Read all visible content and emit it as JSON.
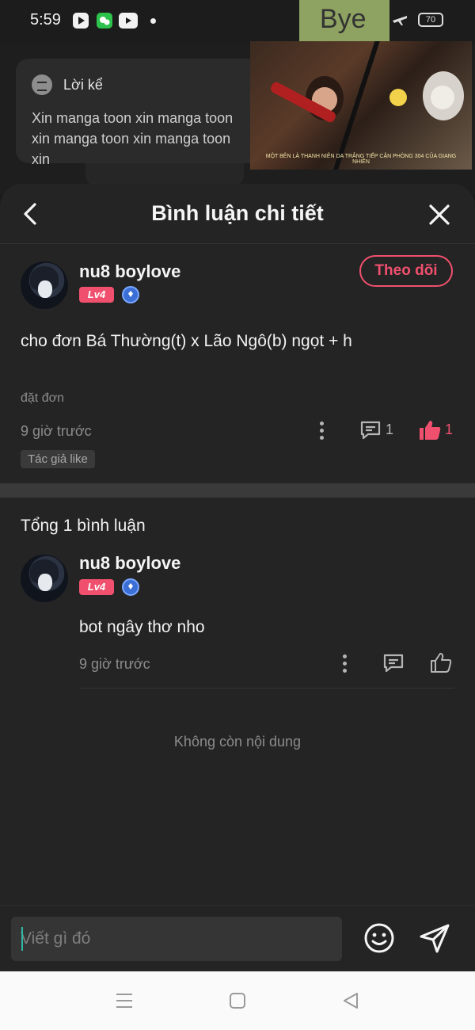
{
  "status_bar": {
    "time": "5:59",
    "battery": "70",
    "icons": [
      "play-store-icon",
      "wechat-icon",
      "youtube-icon",
      "alarm-icon",
      "wifi-icon",
      "airplane-icon",
      "battery-icon"
    ]
  },
  "background_story": {
    "tag_label": "Lời kể",
    "text": "Xin manga toon xin manga toon xin manga toon xin manga toon xin"
  },
  "video_overlay": {
    "bye_label": "Bye",
    "caption": "MỘT BÊN LÀ THANH NIÊN DA TRẮNG TIẾP CẬN PHÒNG 304 CỦA GIANG NHIÊN"
  },
  "sheet": {
    "title": "Bình luận chi tiết"
  },
  "main_comment": {
    "username": "nu8 boylove",
    "level": "Lv4",
    "follow_label": "Theo dõi",
    "text": "cho đơn Bá Thường(t) x Lão Ngô(b) ngọt + h",
    "sub_label": "đặt đơn",
    "time": "9 giờ trước",
    "reply_count": "1",
    "like_count": "1",
    "author_like_badge": "Tác giả like"
  },
  "replies": {
    "total_label": "Tổng 1 bình luận",
    "items": [
      {
        "username": "nu8 boylove",
        "level": "Lv4",
        "text": "bot ngây thơ nho",
        "time": "9 giờ trước"
      }
    ],
    "end_label": "Không còn nội dung"
  },
  "input": {
    "placeholder": "Viết gì đó"
  },
  "colors": {
    "accent": "#f0506e",
    "background": "#242424",
    "caret": "#2fb8a4"
  }
}
